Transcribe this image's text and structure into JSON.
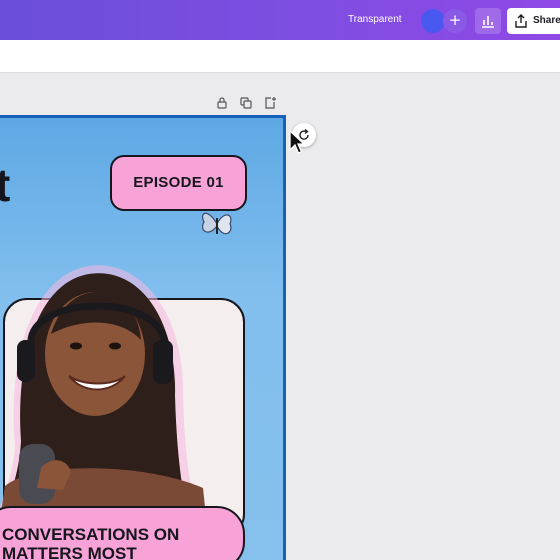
{
  "topbar": {
    "transparent_label": "Transparent",
    "add_icon": "+",
    "share_label": "Share",
    "accent_gradient": [
      "#6a4fd8",
      "#8f49e6"
    ]
  },
  "page_actions": [
    "lock-icon",
    "duplicate-icon",
    "add-page-icon"
  ],
  "design": {
    "big_letter": "t",
    "episode_badge": "EPISODE 01",
    "bottom_line1": "CONVERSATIONS ON",
    "bottom_line2": "MATTERS MOST",
    "colors": {
      "background": "#86c0ec",
      "badge": "#f7a3d7",
      "selection_border": "#1762b9"
    }
  },
  "canvas_controls": {
    "rotate_icon": "rotate-icon",
    "cursor_icon": "pointer-cursor-icon"
  }
}
